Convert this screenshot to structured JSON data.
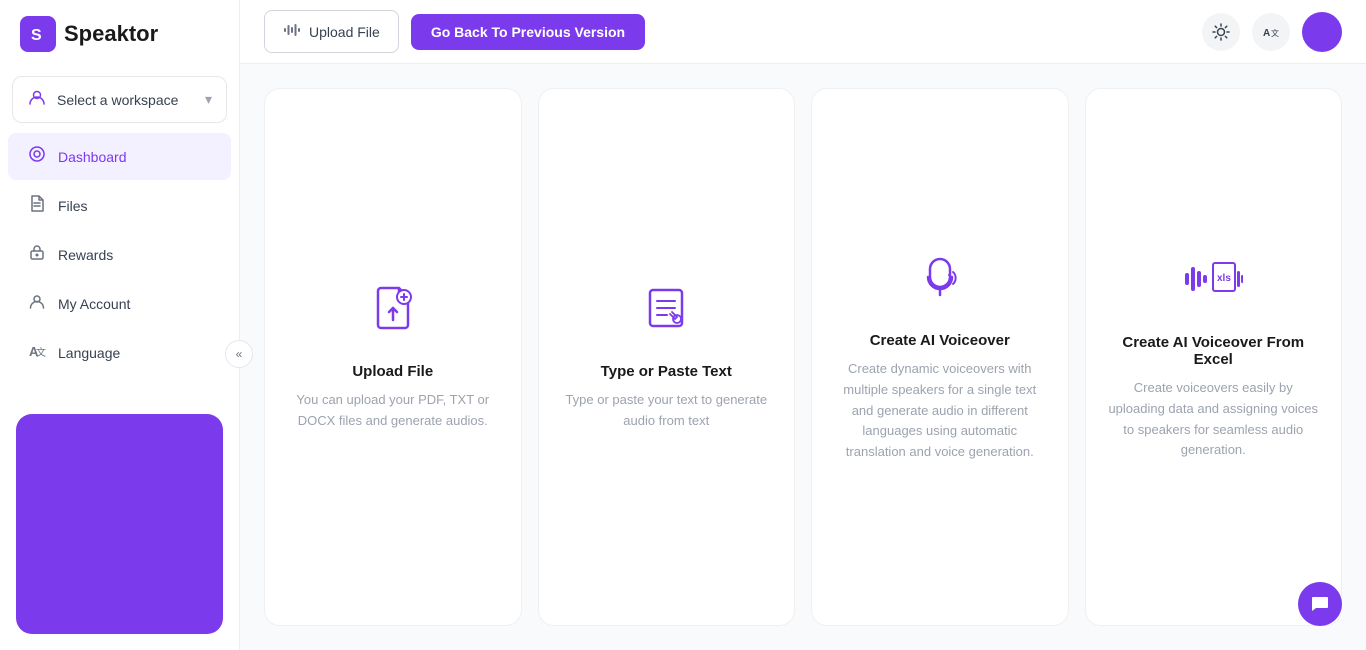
{
  "brand": {
    "name": "Speaktor",
    "logo_letter": "S"
  },
  "sidebar": {
    "workspace": {
      "label": "Select a workspace",
      "chevron": "▾"
    },
    "nav_items": [
      {
        "id": "dashboard",
        "label": "Dashboard",
        "active": true,
        "icon": "dashboard"
      },
      {
        "id": "files",
        "label": "Files",
        "active": false,
        "icon": "files"
      },
      {
        "id": "rewards",
        "label": "Rewards",
        "active": false,
        "icon": "rewards"
      },
      {
        "id": "account",
        "label": "My Account",
        "active": false,
        "icon": "account"
      },
      {
        "id": "language",
        "label": "Language",
        "active": false,
        "icon": "language"
      }
    ],
    "collapse_label": "«"
  },
  "topbar": {
    "upload_label": "Upload File",
    "go_back_label": "Go Back To Previous Version"
  },
  "cards": [
    {
      "id": "upload-file",
      "title": "Upload File",
      "description": "You can upload your PDF, TXT or DOCX files and generate audios.",
      "icon": "upload-file"
    },
    {
      "id": "type-paste",
      "title": "Type or Paste Text",
      "description": "Type or paste your text to generate audio from text",
      "icon": "type-paste"
    },
    {
      "id": "ai-voiceover",
      "title": "Create AI Voiceover",
      "description": "Create dynamic voiceovers with multiple speakers for a single text and generate audio in different languages using automatic translation and voice generation.",
      "icon": "ai-voiceover"
    },
    {
      "id": "ai-voiceover-excel",
      "title": "Create AI Voiceover From Excel",
      "description": "Create voiceovers easily by uploading data and assigning voices to speakers for seamless audio generation.",
      "icon": "ai-voiceover-excel"
    }
  ],
  "colors": {
    "brand": "#7c3aed",
    "brand_light": "#f3f0ff"
  }
}
